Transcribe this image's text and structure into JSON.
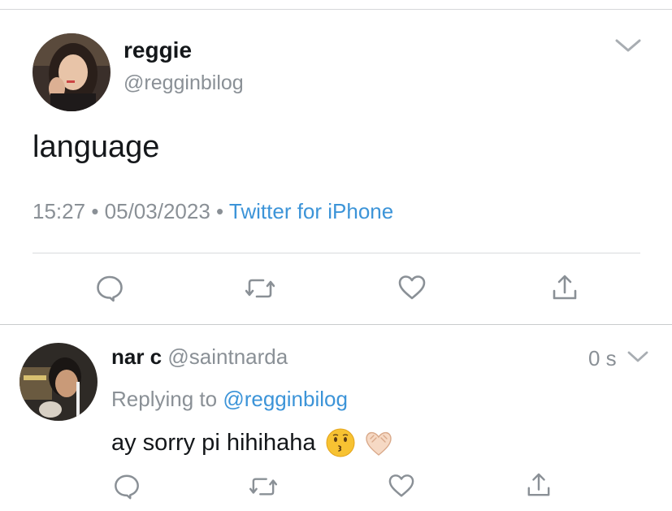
{
  "main_tweet": {
    "display_name": "reggie",
    "handle": "@regginbilog",
    "text": "language",
    "time": "15:27",
    "date": "05/03/2023",
    "dot": "•",
    "source": "Twitter for iPhone"
  },
  "reply": {
    "display_name": "nar c",
    "handle": "@saintnarda",
    "age": "0 s",
    "replying_prefix": "Replying to",
    "replying_handle": "@regginbilog",
    "text": "ay sorry pi hihihaha",
    "emojis": [
      "kissing-face-emoji",
      "heart-hands-emoji"
    ]
  },
  "icons": [
    "chevron-down-icon",
    "reply-icon",
    "retweet-icon",
    "like-icon",
    "share-icon"
  ],
  "colors": {
    "link": "#3c94d8",
    "muted": "#8a9096",
    "icon": "#8a9096",
    "text": "#14171a",
    "divider": "#d9dbdd"
  }
}
